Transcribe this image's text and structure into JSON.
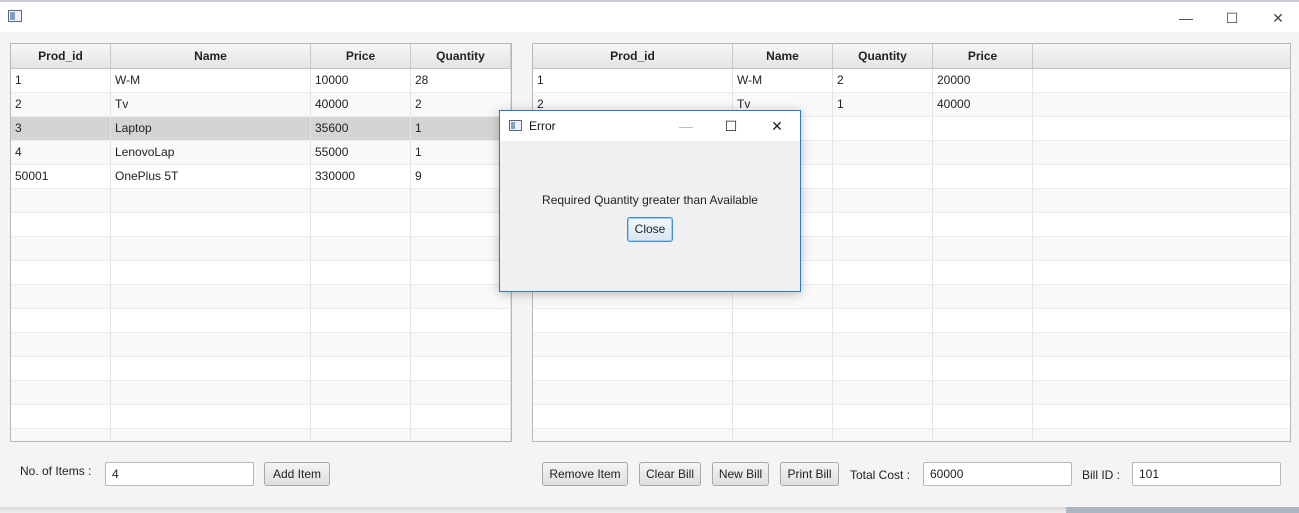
{
  "window": {
    "title": "",
    "controls": {
      "minimize": "—",
      "maximize": "☐",
      "close": "✕"
    }
  },
  "inventory_table": {
    "columns": [
      "Prod_id",
      "Name",
      "Price",
      "Quantity"
    ],
    "rows": [
      [
        "1",
        "W-M",
        "10000",
        "28"
      ],
      [
        "2",
        "Tv",
        "40000",
        "2"
      ],
      [
        "3",
        "Laptop",
        "35600",
        "1"
      ],
      [
        "4",
        "LenovoLap",
        "55000",
        "1"
      ],
      [
        "50001",
        "OnePlus 5T",
        "330000",
        "9"
      ]
    ],
    "selected_row": 3
  },
  "bill_table": {
    "columns": [
      "Prod_id",
      "Name",
      "Quantity",
      "Price"
    ],
    "rows": [
      [
        "1",
        "W-M",
        "2",
        "20000"
      ],
      [
        "2",
        "Tv",
        "1",
        "40000"
      ]
    ]
  },
  "controls": {
    "items_label": "No. of Items :",
    "items_value": "4",
    "add_item": "Add Item",
    "remove_item": "Remove Item",
    "clear_bill": "Clear Bill",
    "new_bill": "New Bill",
    "print_bill": "Print Bill",
    "total_label": "Total Cost :",
    "total_value": "60000",
    "bill_id_label": "Bill ID :",
    "bill_id_value": "101"
  },
  "dialog": {
    "title": "Error",
    "message": "Required Quantity greater than Available",
    "close_button": "Close",
    "controls": {
      "minimize": "—",
      "maximize": "☐",
      "close": "✕"
    }
  },
  "colors": {
    "dialog_border": "#2b79c9",
    "selected_row": "#d4d4d4"
  }
}
